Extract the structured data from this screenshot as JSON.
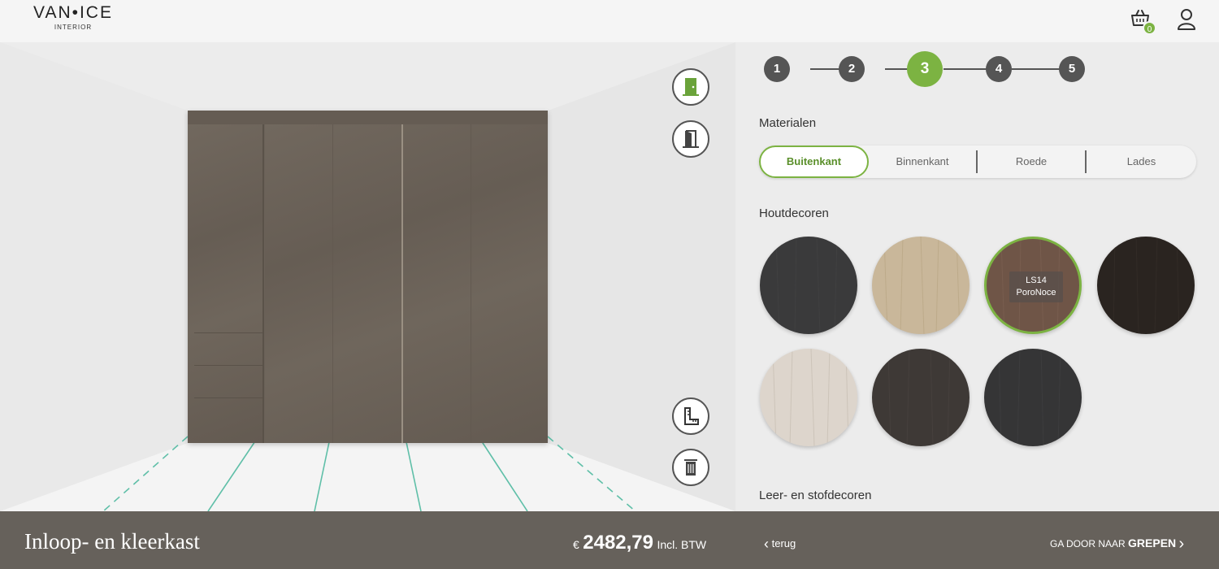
{
  "header": {
    "logo_main": "VAN•ICE",
    "logo_sub": "INTERIOR",
    "cart_count": "0"
  },
  "steps": [
    "1",
    "2",
    "3",
    "4",
    "5"
  ],
  "active_step": "3",
  "materials": {
    "title": "Materialen",
    "tabs": [
      "Buitenkant",
      "Binnenkant",
      "Roede",
      "Lades"
    ],
    "active_tab": "Buitenkant"
  },
  "wood": {
    "title": "Houtdecoren",
    "tooltip_code": "LS14",
    "tooltip_name": "PoroNoce",
    "swatch_colors": [
      "#3a3a3b",
      "#c9b79a",
      "#6f5547",
      "#2a2420",
      "#ddd5cc",
      "#3e3936",
      "#353536"
    ]
  },
  "leather": {
    "title": "Leer- en stofdecoren"
  },
  "footer": {
    "product_title": "Inloop- en kleerkast",
    "currency": "€",
    "price": "2482,79",
    "vat": "Incl. BTW",
    "back": "terug",
    "next_prefix": "GA DOOR NAAR",
    "next_target": "GREPEN"
  },
  "colors": {
    "accent": "#7cb342",
    "footer_bg": "#66615b",
    "wardrobe": "#6b6259",
    "floor_lines": "#5fbfa8"
  }
}
